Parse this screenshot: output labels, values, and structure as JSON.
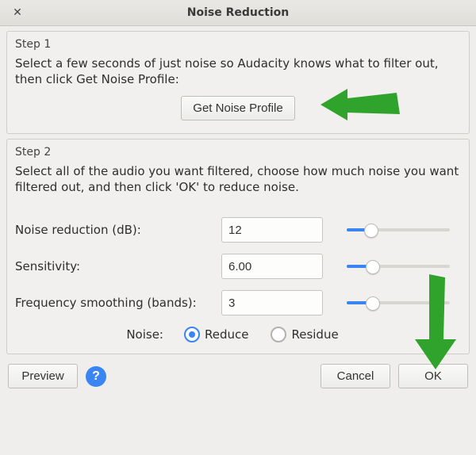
{
  "window": {
    "title": "Noise Reduction"
  },
  "step1": {
    "label": "Step 1",
    "desc": "Select a few seconds of just noise so Audacity knows what to filter out, then click Get Noise Profile:",
    "button": "Get Noise Profile"
  },
  "step2": {
    "label": "Step 2",
    "desc": "Select all of the audio you want filtered, choose how much noise you want filtered out, and then click 'OK' to reduce noise.",
    "params": {
      "noise_reduction": {
        "label": "Noise reduction (dB):",
        "value": "12",
        "fill_pct": 24
      },
      "sensitivity": {
        "label": "Sensitivity:",
        "value": "6.00",
        "fill_pct": 25
      },
      "freq_smoothing": {
        "label": "Frequency smoothing (bands):",
        "value": "3",
        "fill_pct": 25
      }
    },
    "noise_label": "Noise:",
    "radio": {
      "reduce": "Reduce",
      "residue": "Residue",
      "selected": "reduce"
    }
  },
  "buttons": {
    "preview": "Preview",
    "cancel": "Cancel",
    "ok": "OK"
  }
}
